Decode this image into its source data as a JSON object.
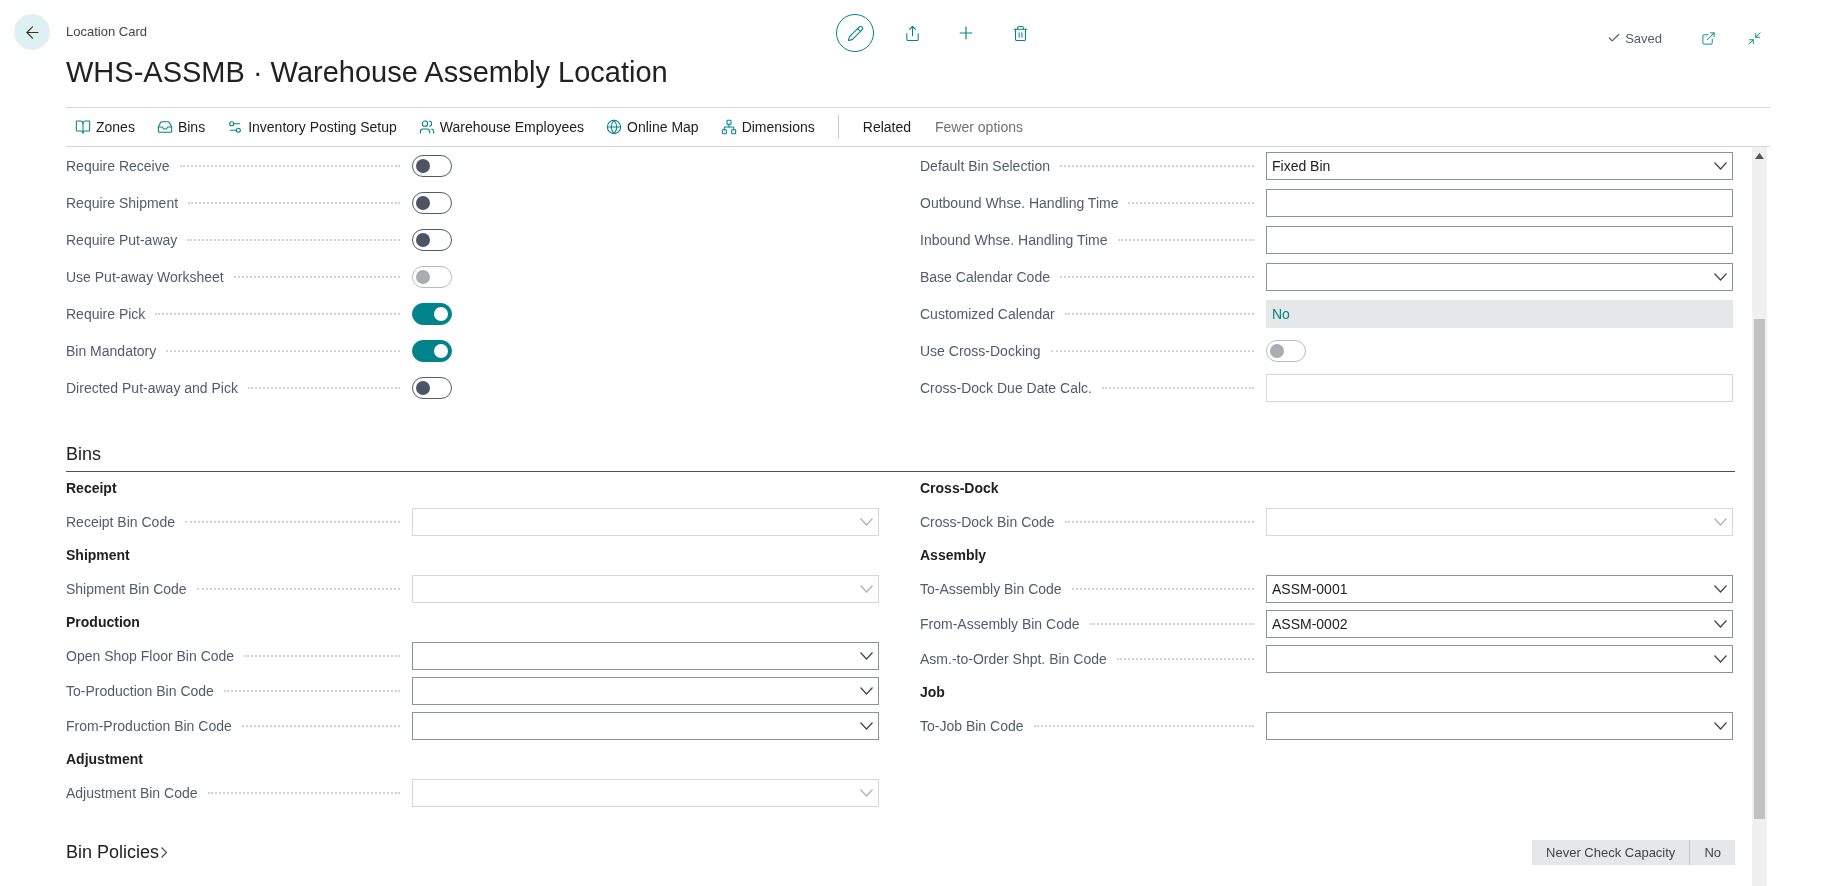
{
  "header": {
    "breadcrumb": "Location Card",
    "title": "WHS-ASSMB · Warehouse Assembly Location",
    "status": "Saved"
  },
  "actions": [
    {
      "label": "Zones"
    },
    {
      "label": "Bins"
    },
    {
      "label": "Inventory Posting Setup"
    },
    {
      "label": "Warehouse Employees"
    },
    {
      "label": "Online Map"
    },
    {
      "label": "Dimensions"
    }
  ],
  "menus": [
    "Related",
    "Fewer options"
  ],
  "warehouse": {
    "left": [
      {
        "label": "Require Receive",
        "kind": "toggle",
        "on": false,
        "disabled": false
      },
      {
        "label": "Require Shipment",
        "kind": "toggle",
        "on": false,
        "disabled": false
      },
      {
        "label": "Require Put-away",
        "kind": "toggle",
        "on": false,
        "disabled": false
      },
      {
        "label": "Use Put-away Worksheet",
        "kind": "toggle",
        "on": false,
        "disabled": true
      },
      {
        "label": "Require Pick",
        "kind": "toggle",
        "on": true,
        "disabled": false
      },
      {
        "label": "Bin Mandatory",
        "kind": "toggle",
        "on": true,
        "disabled": false
      },
      {
        "label": "Directed Put-away and Pick",
        "kind": "toggle",
        "on": false,
        "disabled": false
      }
    ],
    "right": [
      {
        "label": "Default Bin Selection",
        "kind": "select",
        "value": "Fixed Bin",
        "disabled": false
      },
      {
        "label": "Outbound Whse. Handling Time",
        "kind": "text",
        "disabled": false
      },
      {
        "label": "Inbound Whse. Handling Time",
        "kind": "text",
        "disabled": false
      },
      {
        "label": "Base Calendar Code",
        "kind": "select",
        "disabled": false
      },
      {
        "label": "Customized Calendar",
        "kind": "readonly",
        "value": "No",
        "disabled": false
      },
      {
        "label": "Use Cross-Docking",
        "kind": "toggle",
        "on": false,
        "disabled": true
      },
      {
        "label": "Cross-Dock Due Date Calc.",
        "kind": "text",
        "disabled": true
      }
    ]
  },
  "bins": {
    "title": "Bins",
    "left": [
      {
        "title": "Receipt",
        "fields": [
          {
            "label": "Receipt Bin Code",
            "disabled": true
          }
        ]
      },
      {
        "title": "Shipment",
        "fields": [
          {
            "label": "Shipment Bin Code",
            "disabled": true
          }
        ]
      },
      {
        "title": "Production",
        "fields": [
          {
            "label": "Open Shop Floor Bin Code",
            "disabled": false
          },
          {
            "label": "To-Production Bin Code",
            "disabled": false
          },
          {
            "label": "From-Production Bin Code",
            "disabled": false
          }
        ]
      },
      {
        "title": "Adjustment",
        "fields": [
          {
            "label": "Adjustment Bin Code",
            "disabled": true
          }
        ]
      }
    ],
    "right": [
      {
        "title": "Cross-Dock",
        "fields": [
          {
            "label": "Cross-Dock Bin Code",
            "disabled": true
          }
        ]
      },
      {
        "title": "Assembly",
        "fields": [
          {
            "label": "To-Assembly Bin Code",
            "value": "ASSM-0001",
            "disabled": false
          },
          {
            "label": "From-Assembly Bin Code",
            "value": "ASSM-0002",
            "disabled": false
          },
          {
            "label": "Asm.-to-Order Shpt. Bin Code",
            "disabled": false
          }
        ]
      },
      {
        "title": "Job",
        "fields": [
          {
            "label": "To-Job Bin Code",
            "disabled": false
          }
        ]
      }
    ]
  },
  "bin_policies": {
    "title": "Bin Policies",
    "summary": [
      "Never Check Capacity",
      "No"
    ]
  }
}
